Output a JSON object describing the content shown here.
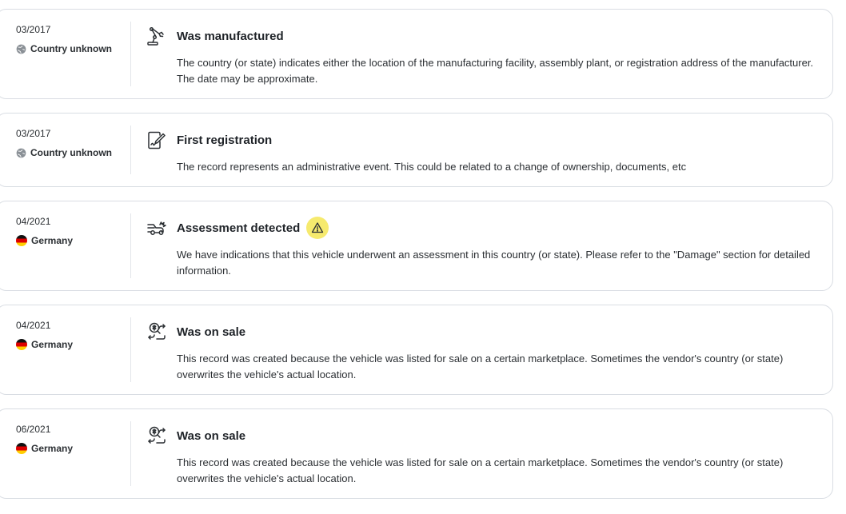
{
  "events": [
    {
      "date": "03/2017",
      "country": "Country unknown",
      "country_icon": "globe-icon",
      "event_icon": "robot-arm-icon",
      "title": "Was manufactured",
      "description": "The country (or state) indicates either the location of the manufacturing facility, assembly plant, or registration address of the manufacturer. The date may be approximate."
    },
    {
      "date": "03/2017",
      "country": "Country unknown",
      "country_icon": "globe-icon",
      "event_icon": "document-sign-icon",
      "title": "First registration",
      "description": "The record represents an administrative event. This could be related to a change of ownership, documents, etc"
    },
    {
      "date": "04/2021",
      "country": "Germany",
      "country_icon": "germany-flag-icon",
      "event_icon": "car-crash-icon",
      "title": "Assessment detected",
      "warning_icon": "warning-icon",
      "warning_color": "#f6ea6e",
      "description": "We have indications that this vehicle underwent an assessment in this country (or state). Please refer to the \"Damage\" section for detailed information."
    },
    {
      "date": "04/2021",
      "country": "Germany",
      "country_icon": "germany-flag-icon",
      "event_icon": "sale-tag-icon",
      "title": "Was on sale",
      "description": "This record was created because the vehicle was listed for sale on a certain marketplace. Sometimes the vendor's country (or state) overwrites the vehicle's actual location."
    },
    {
      "date": "06/2021",
      "country": "Germany",
      "country_icon": "germany-flag-icon",
      "event_icon": "sale-tag-icon",
      "title": "Was on sale",
      "description": "This record was created because the vehicle was listed for sale on a certain marketplace. Sometimes the vendor's country (or state) overwrites the vehicle's actual location."
    }
  ]
}
